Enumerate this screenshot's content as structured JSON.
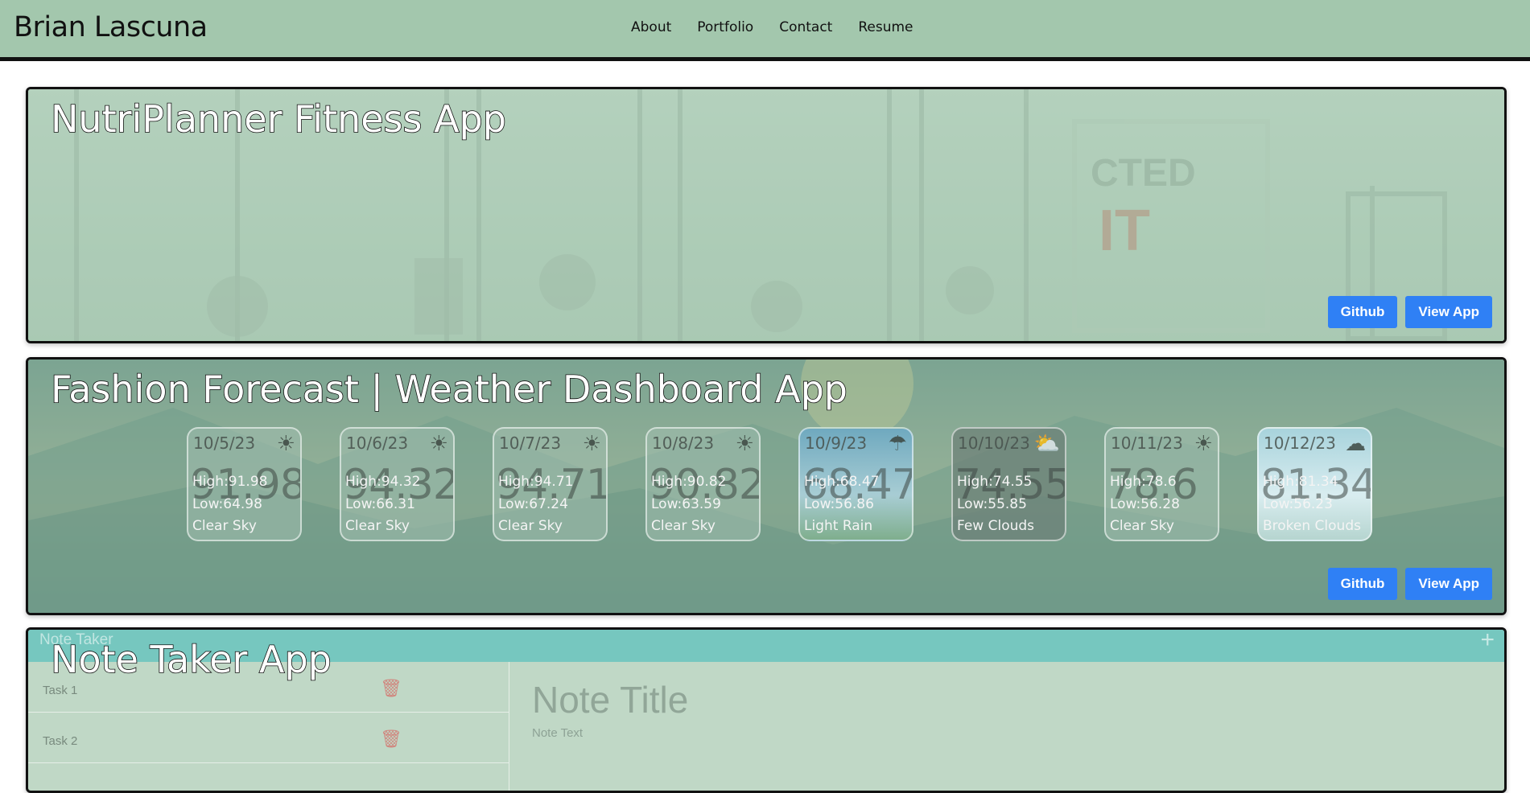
{
  "navbar": {
    "brand": "Brian Lascuna",
    "links": [
      "About",
      "Portfolio",
      "Contact",
      "Resume"
    ]
  },
  "projects": [
    {
      "title": "NutriPlanner Fitness App",
      "github_label": "Github",
      "view_label": "View App"
    },
    {
      "title": "Fashion Forecast | Weather Dashboard App",
      "github_label": "Github",
      "view_label": "View App",
      "forecast": [
        {
          "date": "10/5/23",
          "big": "91.98",
          "high": "High:91.98",
          "low": "Low:64.98",
          "desc": "Clear Sky",
          "icon": "sun-icon",
          "variant": "plain"
        },
        {
          "date": "10/6/23",
          "big": "94.32",
          "high": "High:94.32",
          "low": "Low:66.31",
          "desc": "Clear Sky",
          "icon": "sun-icon",
          "variant": "plain"
        },
        {
          "date": "10/7/23",
          "big": "94.71",
          "high": "High:94.71",
          "low": "Low:67.24",
          "desc": "Clear Sky",
          "icon": "sun-icon",
          "variant": "plain"
        },
        {
          "date": "10/8/23",
          "big": "90.82",
          "high": "High:90.82",
          "low": "Low:63.59",
          "desc": "Clear Sky",
          "icon": "sun-icon",
          "variant": "plain"
        },
        {
          "date": "10/9/23",
          "big": "68.47",
          "high": "High:68.47",
          "low": "Low:56.86",
          "desc": "Light Rain",
          "icon": "rain-icon",
          "variant": "rain"
        },
        {
          "date": "10/10/23",
          "big": "74.55",
          "high": "High:74.55",
          "low": "Low:55.85",
          "desc": "Few Clouds",
          "icon": "few-clouds-icon",
          "variant": "few"
        },
        {
          "date": "10/11/23",
          "big": "78.6",
          "high": "High:78.6",
          "low": "Low:56.28",
          "desc": "Clear Sky",
          "icon": "sun-icon",
          "variant": "plain"
        },
        {
          "date": "10/12/23",
          "big": "81.34",
          "high": "High:81.34",
          "low": "Low:56.23",
          "desc": "Broken Clouds",
          "icon": "cloud-icon",
          "variant": "cloud"
        }
      ]
    },
    {
      "title": "Note Taker App",
      "header_label": "Note Taker",
      "notes": [
        "Task 1",
        "Task 2"
      ],
      "note_title": "Note Title",
      "note_text": "Note Text"
    }
  ],
  "colors": {
    "navbar": "#a3c7ad",
    "button": "#2f80f5",
    "note_header": "#76c7bf"
  }
}
